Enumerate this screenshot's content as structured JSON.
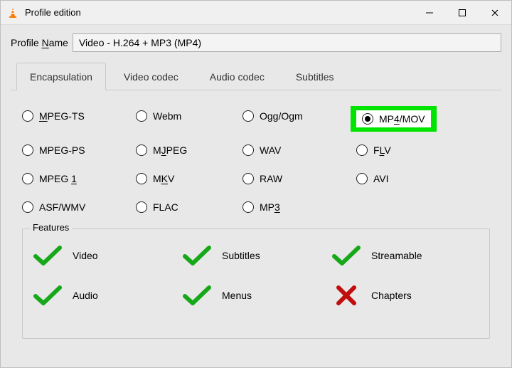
{
  "window": {
    "title": "Profile edition"
  },
  "profile": {
    "name_label_prefix": "Profile ",
    "name_label_accel": "N",
    "name_label_suffix": "ame",
    "name_value": "Video - H.264 + MP3 (MP4)"
  },
  "tabs": {
    "encapsulation": "Encapsulation",
    "video_codec": "Video codec",
    "audio_codec": "Audio codec",
    "subtitles": "Subtitles",
    "active": "encapsulation"
  },
  "encapsulation": {
    "options": [
      {
        "key": "mpeg_ts",
        "label_pre": "",
        "accel": "M",
        "label_post": "PEG-TS",
        "checked": false
      },
      {
        "key": "webm",
        "label_pre": "Webm",
        "accel": "",
        "label_post": "",
        "checked": false
      },
      {
        "key": "ogg",
        "label_pre": "Ogg/Ogm",
        "accel": "",
        "label_post": "",
        "checked": false
      },
      {
        "key": "mp4",
        "label_pre": "MP",
        "accel": "4",
        "label_post": "/MOV",
        "checked": true,
        "highlight": true
      },
      {
        "key": "mpeg_ps",
        "label_pre": "MPEG-PS",
        "accel": "",
        "label_post": "",
        "checked": false
      },
      {
        "key": "mjpeg",
        "label_pre": "M",
        "accel": "J",
        "label_post": "PEG",
        "checked": false
      },
      {
        "key": "wav",
        "label_pre": "WAV",
        "accel": "",
        "label_post": "",
        "checked": false
      },
      {
        "key": "flv",
        "label_pre": "F",
        "accel": "L",
        "label_post": "V",
        "checked": false
      },
      {
        "key": "mpeg1",
        "label_pre": "MPEG ",
        "accel": "1",
        "label_post": "",
        "checked": false
      },
      {
        "key": "mkv",
        "label_pre": "M",
        "accel": "K",
        "label_post": "V",
        "checked": false
      },
      {
        "key": "raw",
        "label_pre": "RAW",
        "accel": "",
        "label_post": "",
        "checked": false
      },
      {
        "key": "avi",
        "label_pre": "AVI",
        "accel": "",
        "label_post": "",
        "checked": false
      },
      {
        "key": "asf",
        "label_pre": "ASF/WMV",
        "accel": "",
        "label_post": "",
        "checked": false
      },
      {
        "key": "flac",
        "label_pre": "FLAC",
        "accel": "",
        "label_post": "",
        "checked": false
      },
      {
        "key": "mp3",
        "label_pre": "MP",
        "accel": "3",
        "label_post": "",
        "checked": false
      }
    ]
  },
  "features": {
    "legend": "Features",
    "items": [
      {
        "label": "Video",
        "ok": true
      },
      {
        "label": "Subtitles",
        "ok": true
      },
      {
        "label": "Streamable",
        "ok": true
      },
      {
        "label": "Audio",
        "ok": true
      },
      {
        "label": "Menus",
        "ok": true
      },
      {
        "label": "Chapters",
        "ok": false
      }
    ]
  }
}
